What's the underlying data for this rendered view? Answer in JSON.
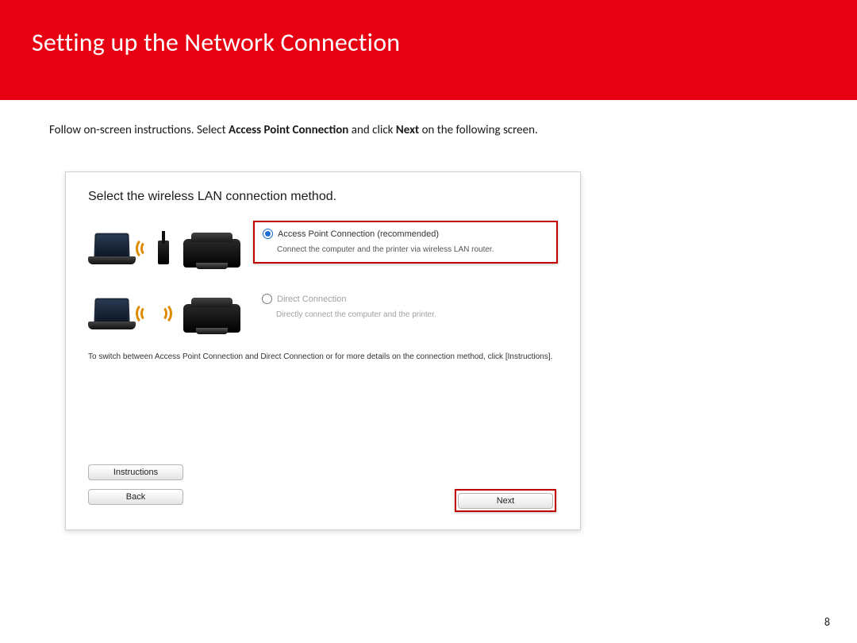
{
  "header": {
    "title": "Setting up the Network Connection"
  },
  "intro": {
    "prefix": "Follow on-screen instructions.  Select ",
    "bold1": "Access Point Connection",
    "mid": " and click ",
    "bold2": "Next",
    "suffix": "  on the following screen."
  },
  "installer": {
    "title": "Select the wireless LAN connection method.",
    "options": [
      {
        "label": "Access Point Connection (recommended)",
        "desc": "Connect the computer and the printer via wireless LAN router.",
        "selected": true
      },
      {
        "label": "Direct Connection",
        "desc": "Directly connect the computer and the printer.",
        "selected": false
      }
    ],
    "hint": "To switch between Access Point Connection and Direct Connection or for more details on the connection method, click [Instructions].",
    "buttons": {
      "instructions": "Instructions",
      "back": "Back",
      "next": "Next"
    }
  },
  "page_number": "8"
}
